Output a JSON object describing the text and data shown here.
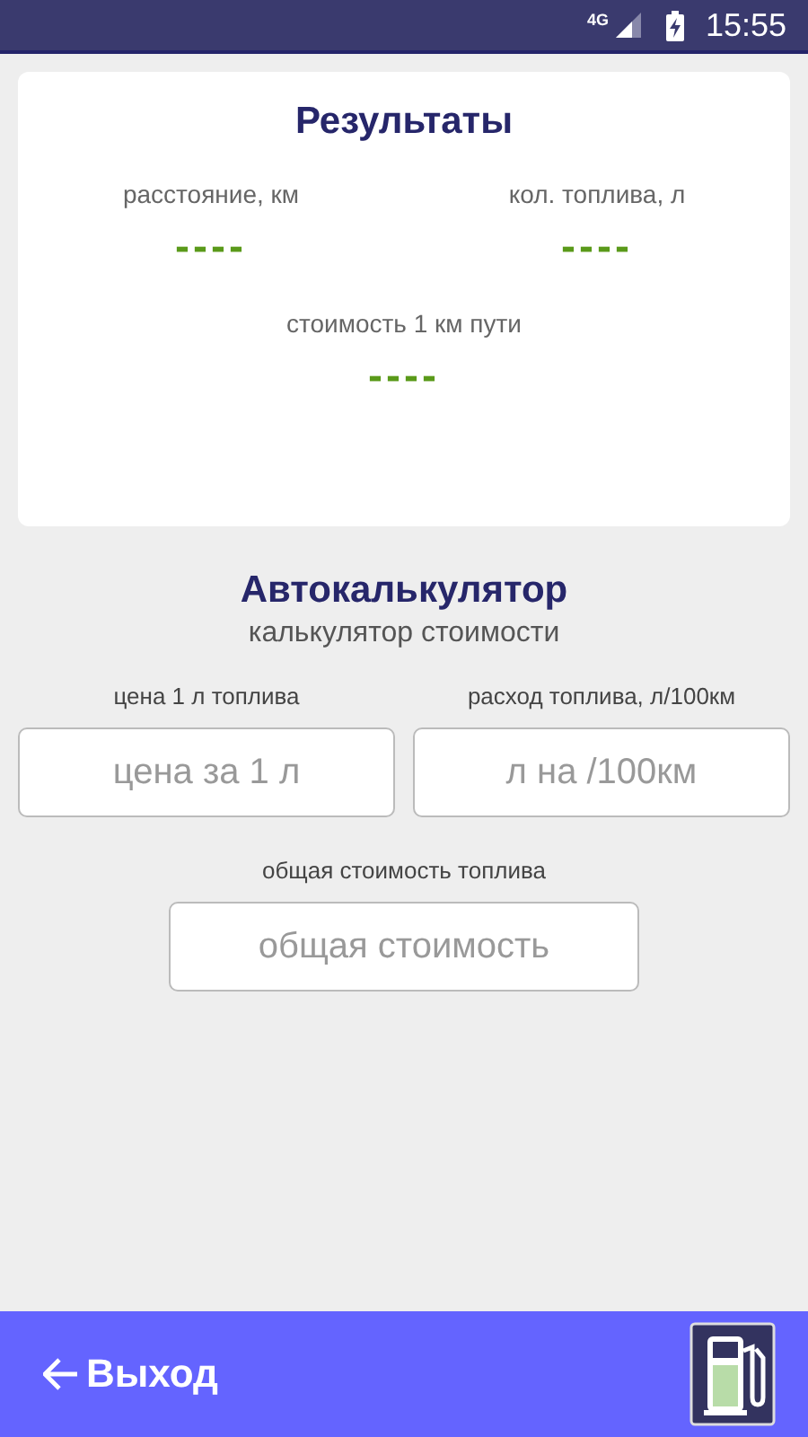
{
  "status_bar": {
    "network": "4G",
    "time": "15:55"
  },
  "results": {
    "title": "Результаты",
    "items": [
      {
        "label": "расстояние, км",
        "value": "----"
      },
      {
        "label": "кол. топлива, л",
        "value": "----"
      },
      {
        "label": "стоимость 1 км пути",
        "value": "----"
      }
    ]
  },
  "calculator": {
    "title": "Автокалькулятор",
    "subtitle": "калькулятор стоимости",
    "fields": [
      {
        "label": "цена 1 л топлива",
        "placeholder": "цена за 1 л"
      },
      {
        "label": "расход топлива, л/100км",
        "placeholder": "л на /100км"
      },
      {
        "label": "общая стоимость топлива",
        "placeholder": "общая стоимость"
      }
    ]
  },
  "bottom_bar": {
    "exit_label": "Выход"
  }
}
